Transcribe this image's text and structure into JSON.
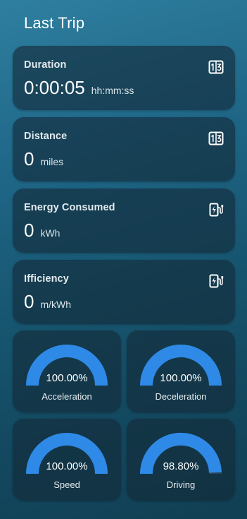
{
  "page": {
    "title": "Last Trip"
  },
  "cards": [
    {
      "label": "Duration",
      "value": "0:00:05",
      "unit": "hh:mm:ss",
      "icon": "counter-icon"
    },
    {
      "label": "Distance",
      "value": "0",
      "unit": "miles",
      "icon": "counter-icon"
    },
    {
      "label": "Energy Consumed",
      "value": "0",
      "unit": "kWh",
      "icon": "ev-charge-icon"
    },
    {
      "label": "Ifficiency",
      "value": "0",
      "unit": "m/kWh",
      "icon": "ev-charge-icon"
    }
  ],
  "gauges": [
    {
      "label": "Acceleration",
      "value_text": "100.00%",
      "value": 100.0
    },
    {
      "label": "Deceleration",
      "value_text": "100.00%",
      "value": 100.0
    },
    {
      "label": "Speed",
      "value_text": "100.00%",
      "value": 100.0
    },
    {
      "label": "Driving",
      "value_text": "98.80%",
      "value": 98.8
    }
  ],
  "colors": {
    "gauge_fill": "#2e8ae6",
    "gauge_track": "#2a4655",
    "card_bg": "#142a38",
    "background_top": "#2f7fa0",
    "background_bottom": "#113f53"
  }
}
